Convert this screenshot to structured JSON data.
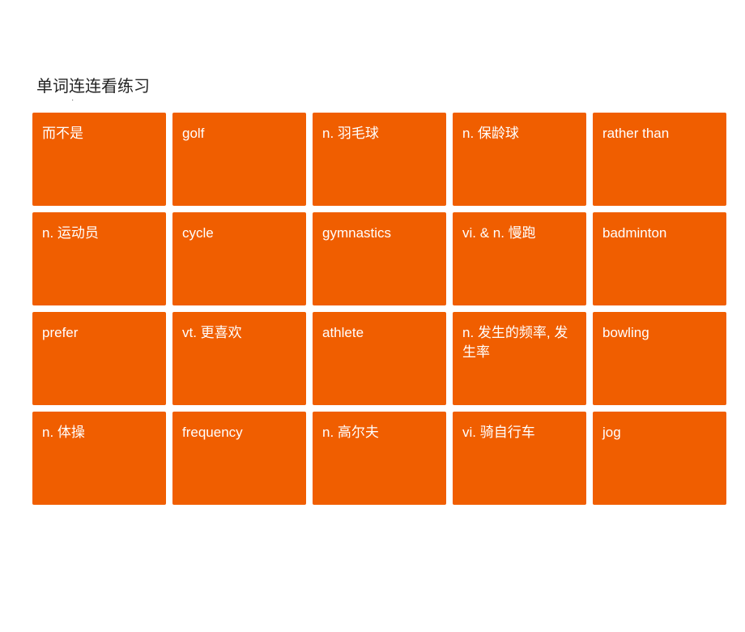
{
  "page": {
    "dot": "·",
    "title": "单词连连看练习",
    "cards": [
      {
        "id": 1,
        "text": "而不是"
      },
      {
        "id": 2,
        "text": "golf"
      },
      {
        "id": 3,
        "text": "n. 羽毛球"
      },
      {
        "id": 4,
        "text": "n. 保龄球"
      },
      {
        "id": 5,
        "text": "rather than"
      },
      {
        "id": 6,
        "text": "n. 运动员"
      },
      {
        "id": 7,
        "text": "cycle"
      },
      {
        "id": 8,
        "text": "gymnastics"
      },
      {
        "id": 9,
        "text": "vi. & n. 慢跑"
      },
      {
        "id": 10,
        "text": "badminton"
      },
      {
        "id": 11,
        "text": "prefer"
      },
      {
        "id": 12,
        "text": "vt. 更喜欢"
      },
      {
        "id": 13,
        "text": "athlete"
      },
      {
        "id": 14,
        "text": "n. 发生的频率,\n发生率"
      },
      {
        "id": 15,
        "text": "bowling"
      },
      {
        "id": 16,
        "text": "n. 体操"
      },
      {
        "id": 17,
        "text": "frequency"
      },
      {
        "id": 18,
        "text": "n. 高尔夫"
      },
      {
        "id": 19,
        "text": "vi. 骑自行车"
      },
      {
        "id": 20,
        "text": "jog"
      }
    ],
    "accent_color": "#f05e00"
  }
}
